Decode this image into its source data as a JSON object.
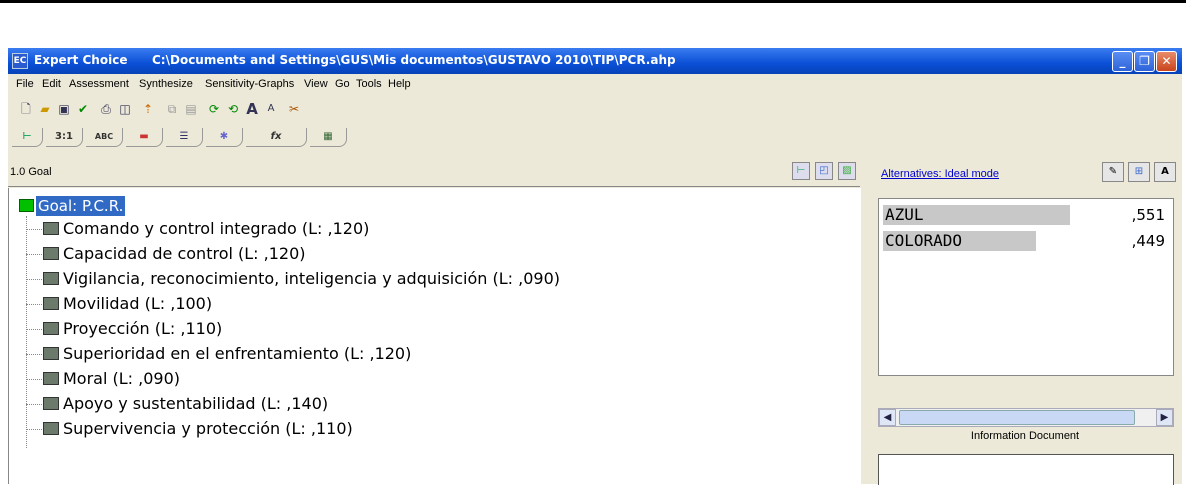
{
  "titlebar": {
    "app_icon_text": "EC",
    "app_name": "Expert Choice",
    "file_path": "C:\\Documents and Settings\\GUS\\Mis documentos\\GUSTAVO 2010\\TIP\\PCR.ahp",
    "minimize": "_",
    "restore": "❐",
    "close": "✕"
  },
  "menu": [
    "File",
    "Edit",
    "Assessment",
    "Synthesize",
    "Sensitivity-Graphs",
    "View",
    "Go",
    "Tools",
    "Help"
  ],
  "toolbar_icons": [
    "new-file-icon",
    "open-folder-icon",
    "save-icon",
    "check-icon",
    "print-icon",
    "print-preview-icon",
    "pointer-icon",
    "copy-icon",
    "paste-icon",
    "green-arrow-icon",
    "green-arrows-icon",
    "font-larger-icon",
    "font-smaller-icon",
    "tool-icon"
  ],
  "tabs": [
    {
      "name": "tab-tree",
      "label": "⊢"
    },
    {
      "name": "tab-pairwise",
      "label": "3:1"
    },
    {
      "name": "tab-verbal",
      "label": "ABC"
    },
    {
      "name": "tab-graphical",
      "label": "▬"
    },
    {
      "name": "tab-bars",
      "label": "☰"
    },
    {
      "name": "tab-questionnaire",
      "label": "✱"
    },
    {
      "name": "tab-formula",
      "label": "fx"
    },
    {
      "name": "tab-grid",
      "label": "▦"
    }
  ],
  "left": {
    "header_label": "1.0 Goal",
    "goal_label": "Goal: P.C.R.",
    "nodes": [
      "Comando y control integrado (L: ,120)",
      "Capacidad de control (L: ,120)",
      "Vigilancia, reconocimiento, inteligencia y adquisición (L: ,090)",
      "Movilidad (L: ,100)",
      "Proyección (L: ,110)",
      "Superioridad en el enfrentamiento (L: ,120)",
      "Moral (L: ,090)",
      "Apoyo y sustentabilidad (L: ,140)",
      "Supervivencia y protección (L: ,110)"
    ]
  },
  "right": {
    "alternatives_link": "Alternatives: Ideal mode",
    "alternatives": [
      {
        "name": "AZUL",
        "value": ",551",
        "share": 0.551
      },
      {
        "name": "COLORADO",
        "value": ",449",
        "share": 0.449
      }
    ],
    "info_title": "Information Document"
  },
  "colors": {
    "goal_square": "#00c000",
    "node_square": "#6b7a6b",
    "selection": "#316ac5",
    "titlebar": "#0a4fd6"
  }
}
